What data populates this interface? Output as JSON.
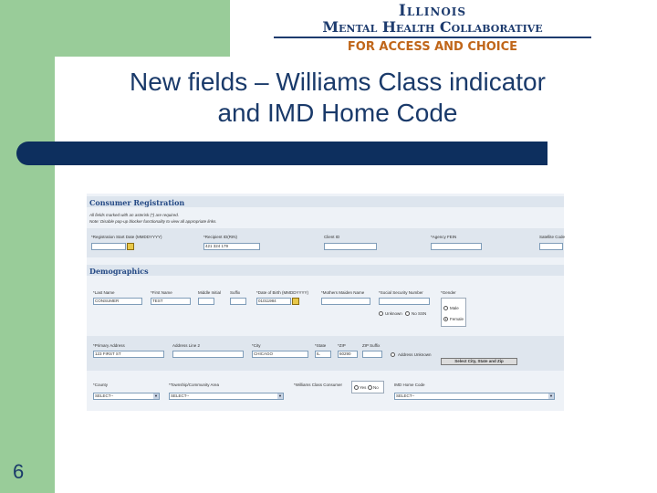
{
  "slide": {
    "title_line1": "New fields – Williams Class indicator",
    "title_line2": "and IMD Home Code",
    "number": "6"
  },
  "logo": {
    "line1": "Illinois",
    "line2": "Mental Health Collaborative",
    "line3": "FOR ACCESS AND CHOICE"
  },
  "colors": {
    "green": "#99cc99",
    "navy": "#0d2f5e",
    "logo_orange": "#c0661a"
  },
  "form": {
    "registration": {
      "header": "Consumer Registration",
      "note1": "All fields marked with an asterisk (*) are required.",
      "note2": "Note: Disable pop-up blocker functionality to view all appropriate links.",
      "start_date_label": "*Registration Start Date (MMDDYYYY)",
      "recipient_label": "*Recipient ID(RIN)",
      "recipient_value": "421 324 179",
      "client_id_label": "Client ID",
      "agency_fein_label": "*Agency FEIN",
      "satellite_label": "Satellite Code"
    },
    "demographics": {
      "header": "Demographics",
      "last_name_label": "*Last Name",
      "last_name_value": "CONSUMER",
      "first_name_label": "*First Name",
      "first_name_value": "TEST",
      "middle_label": "Middle Initial",
      "suffix_label": "Suffix",
      "dob_label": "*Date of Birth (MMDDYYYY)",
      "dob_value": "01011984",
      "mother_label": "*Mothers Maiden Name",
      "ssn_label": "*Social Security Number",
      "unknown_label": "Unknown",
      "no_ssn_label": "No SSN",
      "gender_label": "*Gender",
      "male_label": "Male",
      "female_label": "Female",
      "address1_label": "*Primary Address",
      "address1_value": "123 FIRST ST",
      "address2_label": "Address Line 2",
      "city_label": "*City",
      "city_value": "CHICAGO",
      "state_label": "*State",
      "state_value": "IL",
      "zip_label": "*ZIP",
      "zip_value": "60290",
      "zip_suffix_label": "ZIP Suffix",
      "address_unknown_label": "Address Unknown",
      "select_city_button": "Select City, State and Zip",
      "county_label": "*County",
      "county_value": "SELECT--",
      "township_label": "*Township/Community Area",
      "township_value": "SELECT--",
      "williams_label": "*Williams Class Consumer",
      "yes_label": "Yes",
      "no_label": "No",
      "imd_label": "IMD Home Code",
      "imd_value": "SELECT--"
    }
  }
}
